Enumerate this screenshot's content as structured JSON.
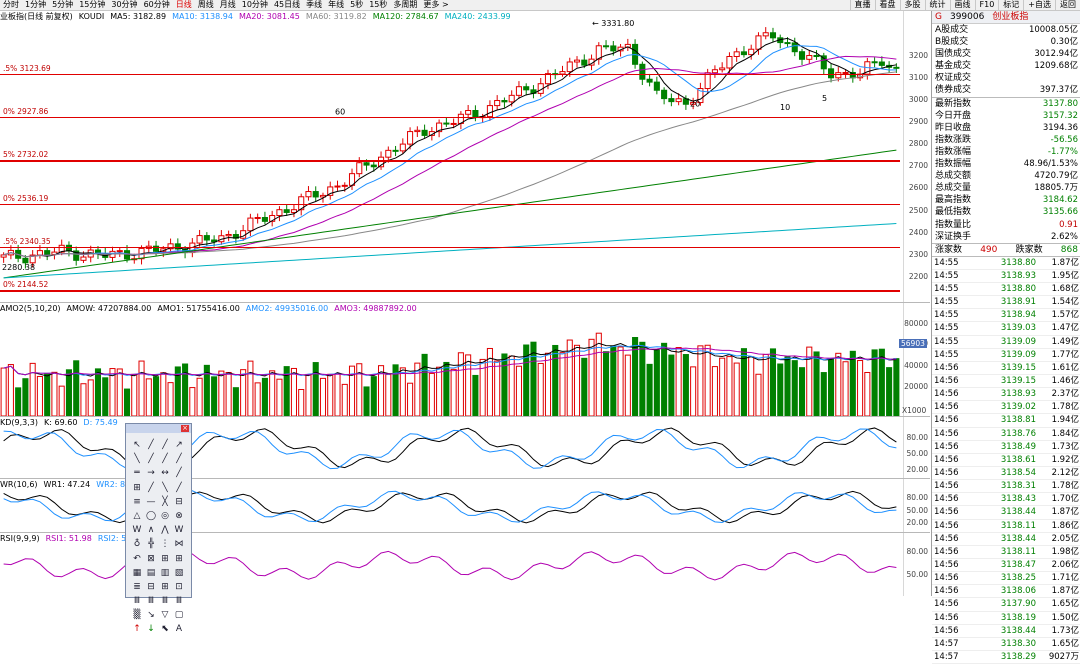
{
  "toolbar": {
    "periods": [
      "分时",
      "1分钟",
      "5分钟",
      "15分钟",
      "30分钟",
      "60分钟",
      "日线",
      "周线",
      "月线",
      "10分钟",
      "45日线",
      "季线",
      "年线",
      "5秒",
      "15秒",
      "多周期",
      "更多 >"
    ],
    "active_period": "日线",
    "right_buttons": [
      "直播",
      "看盘",
      "多股",
      "统计",
      "画线",
      "F10",
      "标记",
      "+自选",
      "返回"
    ]
  },
  "kline": {
    "legend_name": "业板指(日线 前复权)",
    "indicator": "KOUDI",
    "ma": [
      {
        "label": "MA5: 3182.89",
        "color": "#000000"
      },
      {
        "label": "MA10: 3138.94",
        "color": "#1e90ff"
      },
      {
        "label": "MA20: 3081.45",
        "color": "#b000b0"
      },
      {
        "label": "MA60: 3119.82",
        "color": "#888888"
      },
      {
        "label": "MA120: 2784.67",
        "color": "#008000"
      },
      {
        "label": "MA240: 2433.99",
        "color": "#00b0c0"
      }
    ],
    "price_axis": [
      "3200",
      "3100",
      "3000",
      "2900",
      "2800",
      "2700",
      "2600",
      "2500",
      "2400",
      "2300",
      "2200"
    ],
    "fib_lines": [
      "3123.69",
      "2927.86",
      "2732.02",
      "2536.19",
      "2340.35",
      "2144.52"
    ],
    "fib_labels": [
      ".5% 3123.69",
      "0% 2927.86",
      "5% 2732.02",
      "0% 2536.19",
      ".5% 2340.35",
      "0% 2144.52"
    ],
    "high_label": "3331.80",
    "low_label": "2280.38",
    "markers": [
      "60",
      "20",
      "10",
      "5"
    ]
  },
  "volume": {
    "legend": [
      {
        "label": "AMO2(5,10,20)",
        "color": "#000000"
      },
      {
        "label": "AMOW: 47207884.00",
        "color": "#000000"
      },
      {
        "label": "AMO1: 51755416.00",
        "color": "#000000"
      },
      {
        "label": "AMO2: 49935016.00",
        "color": "#1e90ff"
      },
      {
        "label": "AMO3: 49887892.00",
        "color": "#b000b0"
      }
    ],
    "axis": [
      "80000",
      "60000",
      "40000",
      "20000"
    ],
    "current_tag": "56903",
    "unit": "X1000"
  },
  "kdj": {
    "legend": [
      {
        "label": "KD(9,3,3)",
        "color": "#000000"
      },
      {
        "label": "K: 69.60",
        "color": "#000000"
      },
      {
        "label": "D: 75.49",
        "color": "#1e90ff"
      }
    ],
    "axis": [
      "80.00",
      "50.00",
      "20.00"
    ]
  },
  "wr": {
    "legend": [
      {
        "label": "WR(10,6)",
        "color": "#000000"
      },
      {
        "label": "WR1: 47.24",
        "color": "#000000"
      },
      {
        "label": "WR2: 85.33",
        "color": "#1e90ff"
      }
    ],
    "axis": [
      "80.00",
      "50.00",
      "20.00"
    ]
  },
  "rsi": {
    "legend": [
      {
        "label": "RSI(9,9,9)",
        "color": "#000000"
      },
      {
        "label": "RSI1: 51.98",
        "color": "#b000b0"
      },
      {
        "label": "RSI2: 51.98",
        "color": "#1e90ff"
      }
    ],
    "axis": [
      "80.00",
      "50.00"
    ]
  },
  "info": {
    "code": "399006",
    "name": "创业板指",
    "flag": "G",
    "rows_a": [
      {
        "label": "A股成交",
        "value": "10008.05亿"
      },
      {
        "label": "B股成交",
        "value": "0.30亿"
      },
      {
        "label": "国债成交",
        "value": "3012.94亿"
      },
      {
        "label": "基金成交",
        "value": "1209.68亿"
      },
      {
        "label": "权证成交",
        "value": ""
      },
      {
        "label": "债券成交",
        "value": "397.37亿"
      }
    ],
    "rows_b": [
      {
        "label": "最新指数",
        "value": "3137.80",
        "color": "#008000"
      },
      {
        "label": "今日开盘",
        "value": "3157.32",
        "color": "#008000"
      },
      {
        "label": "昨日收盘",
        "value": "3194.36",
        "color": "#000000"
      },
      {
        "label": "指数涨跌",
        "value": "-56.56",
        "color": "#008000"
      },
      {
        "label": "指数涨幅",
        "value": "-1.77%",
        "color": "#008000"
      },
      {
        "label": "指数振幅",
        "value": "48.96/1.53%",
        "color": "#000000"
      },
      {
        "label": "总成交额",
        "value": "4720.79亿",
        "color": "#000000"
      },
      {
        "label": "总成交量",
        "value": "18805.7万",
        "color": "#000000"
      },
      {
        "label": "最高指数",
        "value": "3184.62",
        "color": "#008000"
      },
      {
        "label": "最低指数",
        "value": "3135.66",
        "color": "#008000"
      },
      {
        "label": "指数量比",
        "value": "0.91",
        "color": "#c00000"
      },
      {
        "label": "深证换手",
        "value": "2.62%",
        "color": "#000000"
      }
    ],
    "updown": {
      "up_label": "涨家数",
      "up_value": "490",
      "down_label": "跌家数",
      "down_value": "868"
    },
    "ticks": [
      [
        "14:55",
        "3138.80",
        "1.87亿"
      ],
      [
        "14:55",
        "3138.93",
        "1.95亿"
      ],
      [
        "14:55",
        "3138.80",
        "1.68亿"
      ],
      [
        "14:55",
        "3138.91",
        "1.54亿"
      ],
      [
        "14:55",
        "3138.94",
        "1.57亿"
      ],
      [
        "14:55",
        "3139.03",
        "1.47亿"
      ],
      [
        "14:55",
        "3139.09",
        "1.49亿"
      ],
      [
        "14:55",
        "3139.09",
        "1.77亿"
      ],
      [
        "14:56",
        "3139.15",
        "1.61亿"
      ],
      [
        "14:56",
        "3139.15",
        "1.46亿"
      ],
      [
        "14:56",
        "3138.93",
        "2.37亿"
      ],
      [
        "14:56",
        "3139.02",
        "1.78亿"
      ],
      [
        "14:56",
        "3138.81",
        "1.94亿"
      ],
      [
        "14:56",
        "3138.76",
        "1.84亿"
      ],
      [
        "14:56",
        "3138.49",
        "1.73亿"
      ],
      [
        "14:56",
        "3138.61",
        "1.92亿"
      ],
      [
        "14:56",
        "3138.54",
        "2.12亿"
      ],
      [
        "14:56",
        "3138.31",
        "1.78亿"
      ],
      [
        "14:56",
        "3138.43",
        "1.70亿"
      ],
      [
        "14:56",
        "3138.44",
        "1.87亿"
      ],
      [
        "14:56",
        "3138.11",
        "1.86亿"
      ],
      [
        "14:56",
        "3138.44",
        "2.05亿"
      ],
      [
        "14:56",
        "3138.11",
        "1.98亿"
      ],
      [
        "14:56",
        "3138.47",
        "2.06亿"
      ],
      [
        "14:56",
        "3138.25",
        "1.71亿"
      ],
      [
        "14:56",
        "3138.06",
        "1.87亿"
      ],
      [
        "14:56",
        "3137.90",
        "1.65亿"
      ],
      [
        "14:56",
        "3138.19",
        "1.50亿"
      ],
      [
        "14:56",
        "3138.44",
        "1.73亿"
      ],
      [
        "14:57",
        "3138.30",
        "1.65亿"
      ],
      [
        "14:57",
        "3138.29",
        "9027万"
      ]
    ]
  },
  "toolbox": {
    "glyphs": [
      "↖",
      "╱",
      "╱",
      "↗",
      "╲",
      "╱",
      "╱",
      "╱",
      "═",
      "→",
      "↔",
      "╱",
      "⊞",
      "╱",
      "╲",
      "╱",
      "≡",
      "—",
      "╳",
      "⊟",
      "△",
      "◯",
      "◎",
      "⊗",
      "W",
      "∧",
      "⋀",
      "W",
      "♁",
      "╬",
      "⋮",
      "⋈",
      "↶",
      "⊠",
      "⊞",
      "⊞",
      "▦",
      "▤",
      "▥",
      "▧",
      "≣",
      "⊟",
      "⊞",
      "⊡",
      "Ⅲ",
      "Ⅲ",
      "Ⅲ",
      "Ⅲ",
      "▒",
      "↘",
      "▽",
      "▢",
      "↑",
      "↓",
      "⬉",
      "A"
    ],
    "glyph_colors": {
      "up": "#d00000",
      "down": "#008000"
    }
  }
}
